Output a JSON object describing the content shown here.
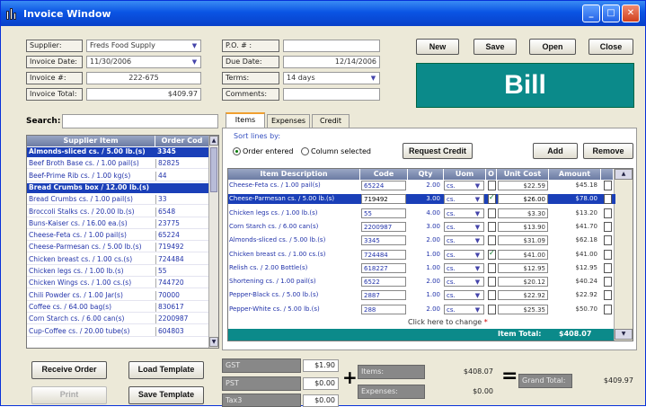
{
  "window": {
    "title": "Invoice Window"
  },
  "header": {
    "supplier_label": "Supplier:",
    "supplier_value": "Freds Food Supply",
    "invoice_date_label": "Invoice Date:",
    "invoice_date_value": "11/30/2006",
    "invoice_no_label": "Invoice #:",
    "invoice_no_value": "222-675",
    "invoice_total_label": "Invoice Total:",
    "invoice_total_value": "$409.97",
    "po_label": "P.O. # :",
    "po_value": "",
    "due_date_label": "Due Date:",
    "due_date_value": "12/14/2006",
    "terms_label": "Terms:",
    "terms_value": "14 days",
    "comments_label": "Comments:",
    "comments_value": ""
  },
  "toolbar": {
    "new": "New",
    "save": "Save",
    "open": "Open",
    "close": "Close"
  },
  "bill_banner": "Bill",
  "search": {
    "label": "Search:",
    "value": ""
  },
  "supplier_items": {
    "col_item": "Supplier Item",
    "col_code": "Order Cod",
    "rows": [
      {
        "item": "Almonds-sliced cs. / 5.00 lb.(s)",
        "code": "3345",
        "selected": true
      },
      {
        "item": "Beef Broth Base cs. / 1.00 pail(s)",
        "code": "82825",
        "selected": false
      },
      {
        "item": "Beef-Prime Rib cs. / 1.00 kg(s)",
        "code": "44",
        "selected": false
      },
      {
        "item": "Bread Crumbs box / 12.00 lb.(s)",
        "code": "",
        "selected": true
      },
      {
        "item": "Bread Crumbs cs. / 1.00 pail(s)",
        "code": "33",
        "selected": false
      },
      {
        "item": "Broccoli Stalks cs. / 20.00 lb.(s)",
        "code": "6548",
        "selected": false
      },
      {
        "item": "Buns-Kaiser cs. / 16.00 ea.(s)",
        "code": "23775",
        "selected": false
      },
      {
        "item": "Cheese-Feta cs. / 1.00 pail(s)",
        "code": "65224",
        "selected": false
      },
      {
        "item": "Cheese-Parmesan cs. / 5.00 lb.(s)",
        "code": "719492",
        "selected": false
      },
      {
        "item": "Chicken breast cs. / 1.00 cs.(s)",
        "code": "724484",
        "selected": false
      },
      {
        "item": "Chicken legs cs. / 1.00 lb.(s)",
        "code": "55",
        "selected": false
      },
      {
        "item": "Chicken Wings cs. / 1.00 cs.(s)",
        "code": "744720",
        "selected": false
      },
      {
        "item": "Chili Powder cs. / 1.00 Jar(s)",
        "code": "70000",
        "selected": false
      },
      {
        "item": "Coffee cs. / 64.00 bag(s)",
        "code": "830617",
        "selected": false
      },
      {
        "item": "Corn Starch cs. / 6.00 can(s)",
        "code": "2200987",
        "selected": false
      },
      {
        "item": "Cup-Coffee cs. / 20.00 tube(s)",
        "code": "604803",
        "selected": false
      }
    ]
  },
  "tabs": [
    {
      "label": "Items",
      "active": true
    },
    {
      "label": "Expenses",
      "active": false
    },
    {
      "label": "Credit",
      "active": false
    }
  ],
  "sort": {
    "label": "Sort lines by:",
    "opt1": "Order entered",
    "opt2": "Column selected"
  },
  "item_buttons": {
    "request_credit": "Request Credit",
    "add": "Add",
    "remove": "Remove"
  },
  "items_table": {
    "cols": {
      "desc": "Item Description",
      "code": "Code",
      "qty": "Qty",
      "uom": "Uom",
      "o": "O",
      "unit_cost": "Unit Cost",
      "amount": "Amount"
    },
    "rows": [
      {
        "desc": "Cheese-Feta cs. / 1.00 pail(s)",
        "code": "65224",
        "qty": "2.00",
        "uom": "cs.",
        "o": false,
        "cost": "$22.59",
        "amount": "$45.18",
        "sel": false
      },
      {
        "desc": "Cheese-Parmesan cs. / 5.00 lb.(s)",
        "code": "719492",
        "qty": "3.00",
        "uom": "cs.",
        "o": true,
        "cost": "$26.00",
        "amount": "$78.00",
        "sel": true
      },
      {
        "desc": "Chicken legs cs. / 1.00 lb.(s)",
        "code": "55",
        "qty": "4.00",
        "uom": "cs.",
        "o": false,
        "cost": "$3.30",
        "amount": "$13.20",
        "sel": false
      },
      {
        "desc": "Corn Starch cs. / 6.00 can(s)",
        "code": "2200987",
        "qty": "3.00",
        "uom": "cs.",
        "o": false,
        "cost": "$13.90",
        "amount": "$41.70",
        "sel": false
      },
      {
        "desc": "Almonds-sliced cs. / 5.00 lb.(s)",
        "code": "3345",
        "qty": "2.00",
        "uom": "cs.",
        "o": false,
        "cost": "$31.09",
        "amount": "$62.18",
        "sel": false
      },
      {
        "desc": "Chicken breast cs. / 1.00 cs.(s)",
        "code": "724484",
        "qty": "1.00",
        "uom": "cs.",
        "o": true,
        "cost": "$41.00",
        "amount": "$41.00",
        "sel": false
      },
      {
        "desc": "Relish cs. / 2.00 Bottle(s)",
        "code": "618227",
        "qty": "1.00",
        "uom": "cs.",
        "o": false,
        "cost": "$12.95",
        "amount": "$12.95",
        "sel": false
      },
      {
        "desc": "Shortening cs. / 1.00 pail(s)",
        "code": "6522",
        "qty": "2.00",
        "uom": "cs.",
        "o": false,
        "cost": "$20.12",
        "amount": "$40.24",
        "sel": false
      },
      {
        "desc": "Pepper-Black cs. / 5.00 lb.(s)",
        "code": "2887",
        "qty": "1.00",
        "uom": "cs.",
        "o": false,
        "cost": "$22.92",
        "amount": "$22.92",
        "sel": false
      },
      {
        "desc": "Pepper-White cs. / 5.00 lb.(s)",
        "code": "288",
        "qty": "2.00",
        "uom": "cs.",
        "o": false,
        "cost": "$25.35",
        "amount": "$50.70",
        "sel": false
      }
    ],
    "change_hint": "Click here to change",
    "total_label": "Item Total:",
    "total_value": "$408.07"
  },
  "bottom": {
    "receive_order": "Receive Order",
    "load_template": "Load Template",
    "print": "Print",
    "save_template": "Save Template",
    "gst_label": "GST",
    "gst_value": "$1.90",
    "pst_label": "PST",
    "pst_value": "$0.00",
    "tax3_label": "Tax3",
    "tax3_value": "$0.00",
    "plus": "+",
    "items_label": "Items:",
    "items_value": "$408.07",
    "expenses_label": "Expenses:",
    "expenses_value": "$0.00",
    "equals": "=",
    "grand_total_label": "Grand Total:",
    "grand_total_value": "$409.97"
  }
}
